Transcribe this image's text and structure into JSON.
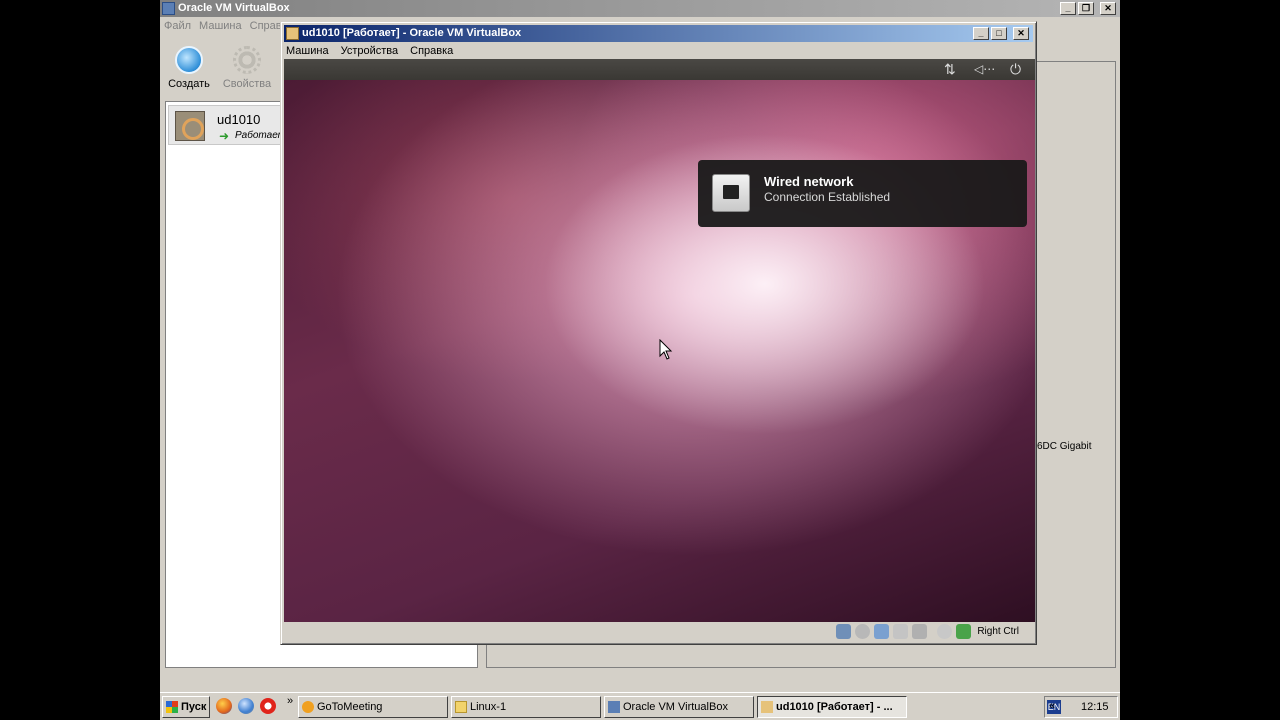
{
  "manager": {
    "title": "Oracle VM VirtualBox",
    "menu": [
      "Файл",
      "Машина",
      "Справ"
    ],
    "toolbar": {
      "create_label": "Создать",
      "properties_label": "Свойства"
    },
    "vm": {
      "name": "ud1010",
      "state": "Работает"
    },
    "details_fragment": "6DC Gigabit"
  },
  "vm_window": {
    "title": "ud1010 [Работает] - Oracle VM VirtualBox",
    "menu": [
      "Машина",
      "Устройства",
      "Справка"
    ],
    "host_key": "Right Ctrl",
    "status_icons": [
      "hard-disk-icon",
      "optical-disk-icon",
      "network-icon",
      "usb-icon",
      "shared-folders-icon",
      "capture-icon",
      "mouse-integration-icon"
    ]
  },
  "guest": {
    "notification": {
      "title": "Wired network",
      "body": "Connection Established"
    },
    "tray_icons": [
      "network-arrows-icon",
      "volume-icon",
      "power-icon"
    ]
  },
  "taskbar": {
    "start_label": "Пуск",
    "quick_launch": [
      "firefox-icon",
      "thunderbird-icon",
      "opera-icon"
    ],
    "overflow": "»",
    "tasks": [
      "GoToMeeting",
      "Linux-1",
      "Oracle VM VirtualBox",
      "ud1010 [Работает] - ..."
    ],
    "language": "EN",
    "tray_arrow": "«",
    "clock": "12:15"
  },
  "colors": {
    "title_active": "#0a246a",
    "title_inactive": "#808080",
    "desktop_face": "#d4d0c8"
  }
}
